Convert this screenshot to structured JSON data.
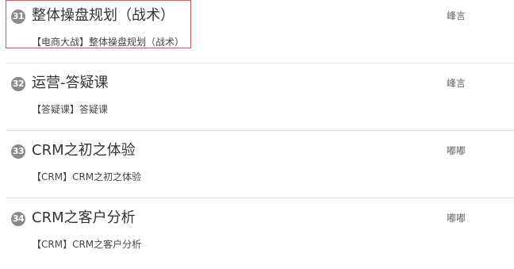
{
  "lessons": [
    {
      "number": "31",
      "title": "整体操盘规划（战术）",
      "subtitle": "【电商大战】整体操盘规划（战术）",
      "teacher": "峰言"
    },
    {
      "number": "32",
      "title": "运营-答疑课",
      "subtitle": "【答疑课】答疑课",
      "teacher": "峰言"
    },
    {
      "number": "33",
      "title": "CRM之初之体验",
      "subtitle": "【CRM】CRM之初之体验",
      "teacher": "嘟嘟"
    },
    {
      "number": "34",
      "title": "CRM之客户分析",
      "subtitle": "【CRM】CRM之客户分析",
      "teacher": "嘟嘟"
    }
  ],
  "highlight_color": "#d9534f",
  "badge_color": "#8a8a8a"
}
